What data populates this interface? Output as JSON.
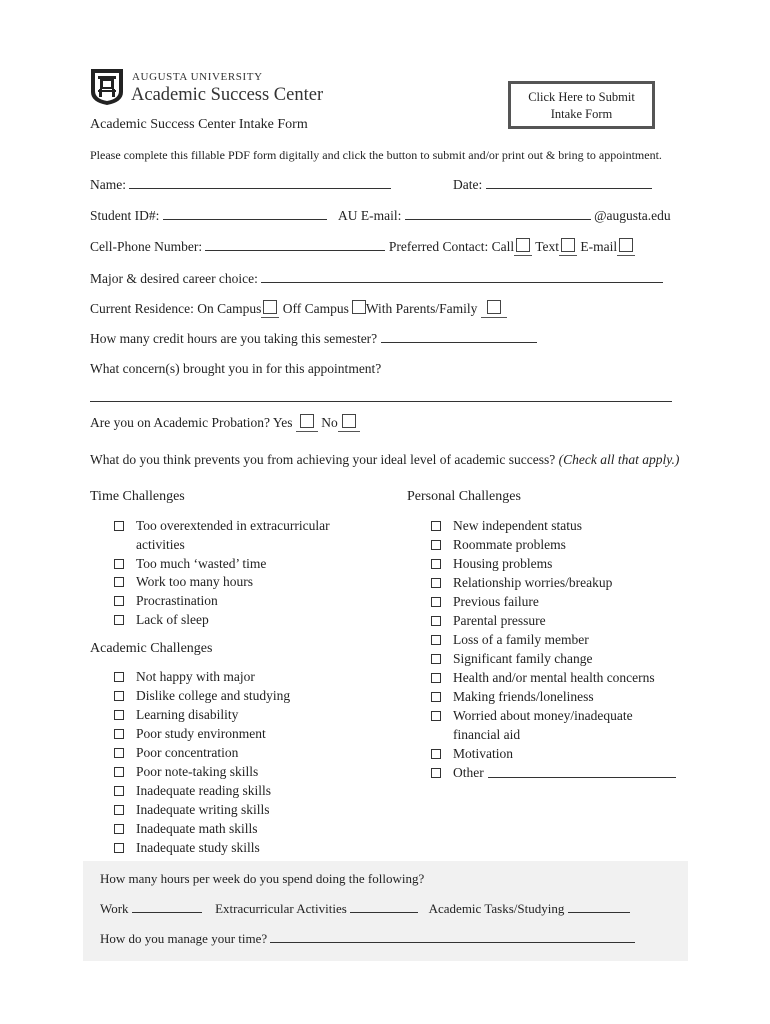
{
  "header": {
    "university": "AUGUSTA UNIVERSITY",
    "department": "Academic Success Center",
    "logo_icon": "university-shield-logo",
    "form_title": "Academic Success Center Intake Form",
    "submit_button_line1": "Click Here to Submit",
    "submit_button_line2": "Intake Form"
  },
  "instructions": "Please complete this fillable PDF form digitally and click the button to submit and/or print out & bring to appointment.",
  "fields": {
    "name_label": "Name:",
    "name_value": "",
    "date_label": "Date:",
    "date_value": "",
    "student_id_label": "Student ID#:",
    "student_id_value": "",
    "email_label": "AU E-mail:",
    "email_value": "",
    "email_suffix": "@augusta.edu",
    "phone_label": "Cell-Phone Number:",
    "phone_value": "",
    "preferred_contact_label": "Preferred Contact:",
    "contact_options": [
      "Call",
      "Text",
      "E-mail"
    ],
    "major_label": "Major & desired career choice:",
    "major_value": "",
    "residence_label": "Current Residence:",
    "residence_options": [
      "On Campus",
      "Off Campus",
      "With Parents/Family"
    ],
    "credit_hours_label": "How many credit hours are you taking this semester?",
    "credit_hours_value": "",
    "concerns_label": "What concern(s) brought you in for this appointment?",
    "concerns_value": "",
    "probation_label": "Are you on Academic Probation?",
    "probation_options": [
      "Yes",
      "No"
    ]
  },
  "challenges_question": "What do you think prevents you from achieving your ideal level of academic success?",
  "challenges_note": "(Check all that apply.)",
  "time_challenges": {
    "title": "Time Challenges",
    "items": [
      {
        "line1": "Too overextended in extracurricular",
        "line2": "activities"
      },
      {
        "line1": "Too much ‘wasted’ time"
      },
      {
        "line1": "Work too many hours"
      },
      {
        "line1": "Procrastination"
      },
      {
        "line1": "Lack of sleep"
      }
    ]
  },
  "academic_challenges": {
    "title": "Academic Challenges",
    "items": [
      "Not happy with major",
      "Dislike college and studying",
      "Learning disability",
      "Poor study environment",
      "Poor concentration",
      "Poor note-taking skills",
      "Inadequate reading skills",
      "Inadequate writing skills",
      "Inadequate math skills",
      "Inadequate study skills"
    ]
  },
  "personal_challenges": {
    "title": "Personal Challenges",
    "items": [
      {
        "line1": "New independent status"
      },
      {
        "line1": "Roommate problems"
      },
      {
        "line1": "Housing problems"
      },
      {
        "line1": "Relationship worries/breakup"
      },
      {
        "line1": "Previous failure"
      },
      {
        "line1": "Parental pressure"
      },
      {
        "line1": "Loss of a family member"
      },
      {
        "line1": "Significant family change"
      },
      {
        "line1": "Health and/or mental health concerns"
      },
      {
        "line1": "Making friends/loneliness"
      },
      {
        "line1": "Worried about money/inadequate",
        "line2": "financial aid"
      },
      {
        "line1": "Motivation"
      },
      {
        "line1": "Other"
      }
    ]
  },
  "hours_section": {
    "question": "How many hours per week do you spend doing the following?",
    "work_label": "Work",
    "extracurricular_label": "Extracurricular Activities",
    "academic_label": "Academic Tasks/Studying",
    "manage_label": "How do you manage your time?",
    "background": "#f1f1f1"
  }
}
